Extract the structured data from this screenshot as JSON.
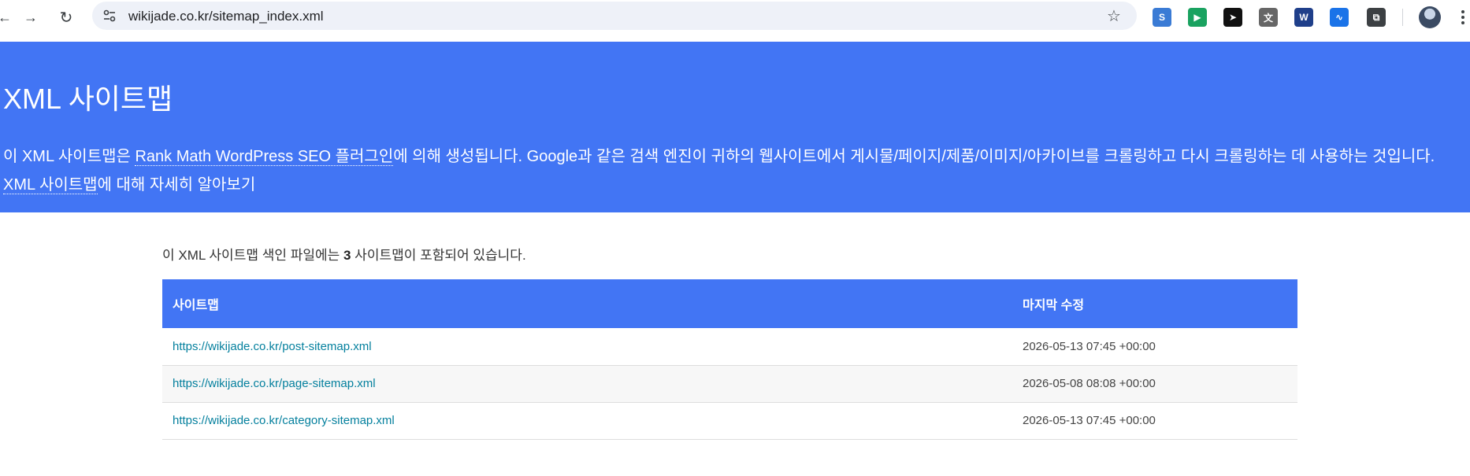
{
  "browser": {
    "url": "wikijade.co.kr/sitemap_index.xml",
    "back_glyph": "←",
    "forward_glyph": "→",
    "reload_glyph": "↻",
    "star_glyph": "☆",
    "extensions": [
      {
        "name": "s-extension-icon",
        "glyph": "S",
        "color": "#3a7bd5"
      },
      {
        "name": "video-extension-icon",
        "glyph": "▶",
        "color": "#1aa260"
      },
      {
        "name": "send-extension-icon",
        "glyph": "➤",
        "color": "#111111"
      },
      {
        "name": "translate-extension-icon",
        "glyph": "文",
        "color": "#666666"
      },
      {
        "name": "w-extension-icon",
        "glyph": "W",
        "color": "#1f3f8a"
      },
      {
        "name": "chart-extension-icon",
        "glyph": "∿",
        "color": "#1a73e8"
      },
      {
        "name": "puzzle-extension-icon",
        "glyph": "⧉",
        "color": "#3c4043"
      }
    ]
  },
  "header": {
    "title": "XML 사이트맵",
    "desc_prefix": "이 XML 사이트맵은 ",
    "desc_link": "Rank Math WordPress SEO 플러그인",
    "desc_suffix": "에 의해 생성됩니다. Google과 같은 검색 엔진이 귀하의 웹사이트에서 게시물/페이지/제품/이미지/아카이브를 크롤링하고 다시 크롤링하는 데 사용하는 것입니다.",
    "learn_link": "XML 사이트맵",
    "learn_suffix": "에 대해 자세히 알아보기"
  },
  "intro": {
    "prefix": "이 XML 사이트맵 색인 파일에는 ",
    "count": "3",
    "suffix": " 사이트맵이 포함되어 있습니다."
  },
  "table": {
    "columns": [
      "사이트맵",
      "마지막 수정"
    ],
    "rows": [
      {
        "url": "https://wikijade.co.kr/post-sitemap.xml",
        "modified": "2026-05-13 07:45 +00:00"
      },
      {
        "url": "https://wikijade.co.kr/page-sitemap.xml",
        "modified": "2026-05-08 08:08 +00:00"
      },
      {
        "url": "https://wikijade.co.kr/category-sitemap.xml",
        "modified": "2026-05-13 07:45 +00:00"
      }
    ]
  },
  "colors": {
    "accent": "#4275f4",
    "link": "#05809e"
  }
}
